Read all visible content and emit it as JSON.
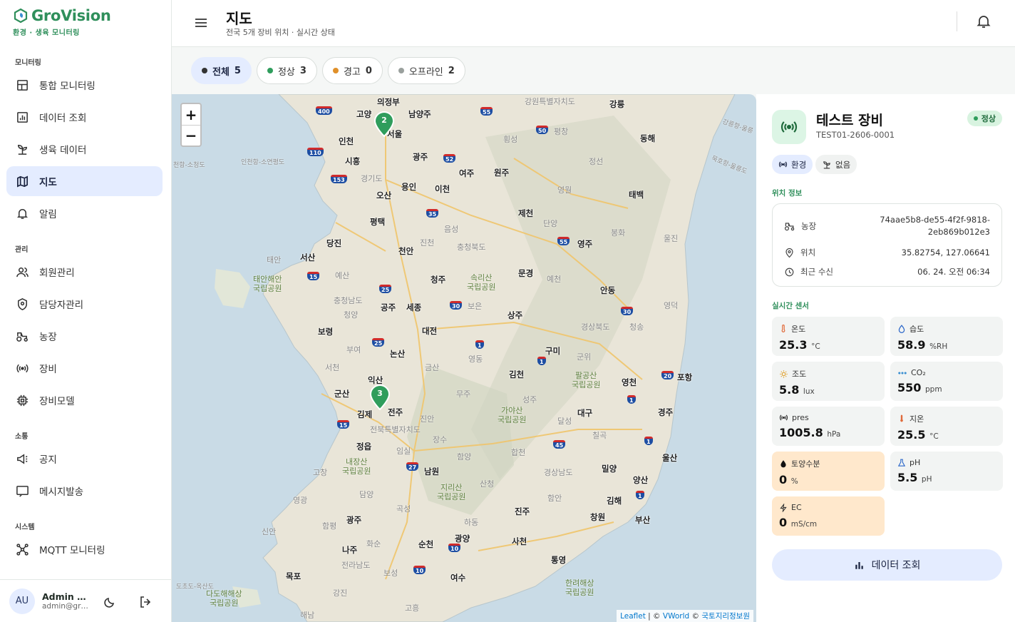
{
  "app": {
    "name": "GroVision",
    "subtitle": "환경 · 생육 모니터링"
  },
  "sidebar": {
    "sections": [
      "모니터링",
      "관리",
      "소통",
      "시스템"
    ],
    "items": [
      {
        "label": "통합 모니터링",
        "icon": "dashboard-icon"
      },
      {
        "label": "데이터 조회",
        "icon": "chart-icon"
      },
      {
        "label": "생육 데이터",
        "icon": "sprout-icon"
      },
      {
        "label": "지도",
        "icon": "map-icon",
        "active": true
      },
      {
        "label": "알림",
        "icon": "bell-icon"
      },
      {
        "label": "회원관리",
        "icon": "users-icon"
      },
      {
        "label": "담당자관리",
        "icon": "shield-icon"
      },
      {
        "label": "농장",
        "icon": "tractor-icon"
      },
      {
        "label": "장비",
        "icon": "signal-icon"
      },
      {
        "label": "장비모델",
        "icon": "chip-icon"
      },
      {
        "label": "공지",
        "icon": "megaphone-icon"
      },
      {
        "label": "메시지발송",
        "icon": "message-icon"
      },
      {
        "label": "MQTT 모니터링",
        "icon": "network-icon"
      }
    ],
    "user": {
      "initials": "AU",
      "name": "Admin …",
      "email": "admin@gr…"
    }
  },
  "header": {
    "title": "지도",
    "subtitle": "전국 5개 장비 위치 · 실시간 상태"
  },
  "filters": [
    {
      "label": "전체",
      "count": "5",
      "color": "#333333",
      "active": true
    },
    {
      "label": "정상",
      "count": "3",
      "color": "#2f9d5c"
    },
    {
      "label": "경고",
      "count": "0",
      "color": "#e0902a"
    },
    {
      "label": "오프라인",
      "count": "2",
      "color": "#9aa09d"
    }
  ],
  "map": {
    "zoom_in": "+",
    "zoom_out": "−",
    "markers": [
      {
        "count": "2"
      },
      {
        "count": "3"
      }
    ],
    "attribution": {
      "leaflet": "Leaflet",
      "sep": " | © ",
      "vworld": "VWorld",
      "mid": " © ",
      "ngii": "국토지리정보원"
    },
    "cities": [
      "의정부",
      "고양",
      "남양주",
      "인천",
      "서울",
      "시흥",
      "광주",
      "여주",
      "원주",
      "용인",
      "이천",
      "오산",
      "평택",
      "강릉",
      "동해",
      "태백",
      "제천",
      "영주",
      "당진",
      "서산",
      "천안",
      "청주",
      "문경",
      "안동",
      "공주",
      "세종",
      "보령",
      "대전",
      "상주",
      "논산",
      "구미",
      "익산",
      "김천",
      "영천",
      "포항",
      "군산",
      "김제",
      "전주",
      "대구",
      "경주",
      "정읍",
      "울산",
      "남원",
      "밀양",
      "양산",
      "김해",
      "광주",
      "진주",
      "창원",
      "부산",
      "나주",
      "순천",
      "광양",
      "사천",
      "통영",
      "목포",
      "여수"
    ],
    "regions": [
      "강원특별자치도",
      "횡성",
      "평창",
      "정선",
      "영월",
      "단양",
      "봉화",
      "울진",
      "음성",
      "충청북도",
      "진천",
      "예천",
      "영덕",
      "경상북도",
      "청송",
      "군위",
      "태안",
      "예산",
      "충청남도",
      "청양",
      "보은",
      "부여",
      "서천",
      "영동",
      "금산",
      "무주",
      "성주",
      "달성",
      "칠곡",
      "청도",
      "진안",
      "장수",
      "합천",
      "고창",
      "임실",
      "함양",
      "경상남도",
      "영광",
      "산청",
      "담양",
      "곡성",
      "하동",
      "함안",
      "함평",
      "화순",
      "신안",
      "전라남도",
      "보성",
      "강진",
      "고흥",
      "해남",
      "전북특별자치도",
      "경기도"
    ],
    "parks": [
      "태안해안\n국립공원",
      "속리산\n국립공원",
      "팔공산\n국립공원",
      "가야산\n국립공원",
      "내장산\n국립공원",
      "지리산\n국립공원",
      "한려해상\n국립공원",
      "다도해해상\n국립공원"
    ],
    "seas": [
      "인천항-소연평도",
      "천항-소청도",
      "강릉항-울릉",
      "묵호항-울릉도",
      "도초도-옥산도"
    ],
    "highways": [
      "400",
      "55",
      "50",
      "110",
      "52",
      "153",
      "35",
      "55",
      "15",
      "25",
      "30",
      "30",
      "25",
      "1",
      "1",
      "20",
      "1",
      "15",
      "45",
      "1",
      "27",
      "1",
      "10",
      "10"
    ]
  },
  "device": {
    "name": "테스트 장비",
    "code": "TEST01-2606-0001",
    "status": "정상",
    "tags": [
      {
        "label": "환경",
        "icon": "signal-icon"
      },
      {
        "label": "없음",
        "icon": "sprout-icon"
      }
    ],
    "location_title": "위치 정보",
    "location": [
      {
        "label": "농장",
        "value": "74aae5b8-de55-4f2f-9818-\n2eb869b012e3",
        "icon": "tractor-icon"
      },
      {
        "label": "위치",
        "value": "35.82754, 127.06641",
        "icon": "pin-icon"
      },
      {
        "label": "최근 수신",
        "value": "06. 24. 오전 06:34",
        "icon": "clock-icon"
      }
    ],
    "sensors_title": "실시간 센서",
    "sensors": [
      {
        "label": "온도",
        "value": "25.3",
        "unit": "°C",
        "icon": "thermometer-icon"
      },
      {
        "label": "습도",
        "value": "58.9",
        "unit": "%RH",
        "icon": "droplet-icon"
      },
      {
        "label": "조도",
        "value": "5.8",
        "unit": "lux",
        "icon": "sun-icon"
      },
      {
        "label": "CO₂",
        "value": "550",
        "unit": "ppm",
        "icon": "co2-icon"
      },
      {
        "label": "pres",
        "value": "1005.8",
        "unit": "hPa",
        "icon": "signal-icon"
      },
      {
        "label": "지온",
        "value": "25.5",
        "unit": "°C",
        "icon": "thermometer-icon"
      },
      {
        "label": "토양수분",
        "value": "0",
        "unit": "%",
        "icon": "drop-fill-icon",
        "warn": true
      },
      {
        "label": "pH",
        "value": "5.5",
        "unit": "pH",
        "icon": "flask-icon"
      },
      {
        "label": "EC",
        "value": "0",
        "unit": "mS/cm",
        "icon": "bolt-icon",
        "warn": true
      }
    ],
    "data_button": "데이터 조회"
  }
}
